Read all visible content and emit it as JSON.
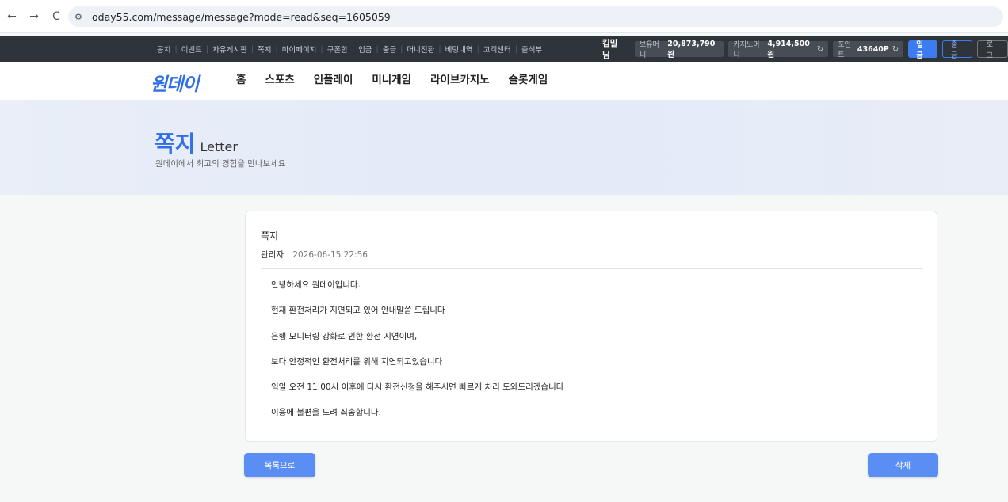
{
  "browser": {
    "back_icon": "←",
    "forward_icon": "→",
    "reload_icon": "C",
    "site_icon": "⚙",
    "url": "oday55.com/message/message?mode=read&seq=1605059"
  },
  "topbar": {
    "links": [
      "공지",
      "이벤트",
      "자유게시판",
      "쪽지",
      "마이페이지",
      "쿠폰함",
      "입금",
      "출금",
      "머니전환",
      "베팅내역",
      "고객센터",
      "출석부"
    ],
    "username": "킵밀 님",
    "balance_label": "보유머니",
    "balance_value": "20,873,790원",
    "casino_label": "카지노머니",
    "casino_value": "4,914,500원",
    "point_label": "포인트",
    "point_value": "43640P",
    "refresh_icon": "↻",
    "deposit": "입금",
    "withdraw": "출금",
    "logout": "로그"
  },
  "nav": {
    "logo": "원데이",
    "items": [
      "홈",
      "스포츠",
      "인플레이",
      "미니게임",
      "라이브카지노",
      "슬롯게임"
    ]
  },
  "hero": {
    "title_ko": "쪽지",
    "title_en": "Letter",
    "subtitle": "원데이에서 최고의 경험을 만나보세요"
  },
  "message": {
    "title": "쪽지",
    "sender": "관리자",
    "date": "2026-06-15 22:56",
    "lines": [
      "안녕하세요 원데이입니다.",
      "현재 환전처리가 지연되고 있어 안내말씀 드립니다",
      "은행 모니터링 강화로 인한 환전 지연이며,",
      "보다 안정적인 환전처리를 위해 지연되고있습니다",
      "익일 오전 11:00시 이후에 다시 환전신청을 해주시면 빠르게 처리 도와드리겠습니다",
      "이용에 불편을 드려 죄송합니다."
    ]
  },
  "actions": {
    "list": "목록으로",
    "delete": "삭제"
  }
}
